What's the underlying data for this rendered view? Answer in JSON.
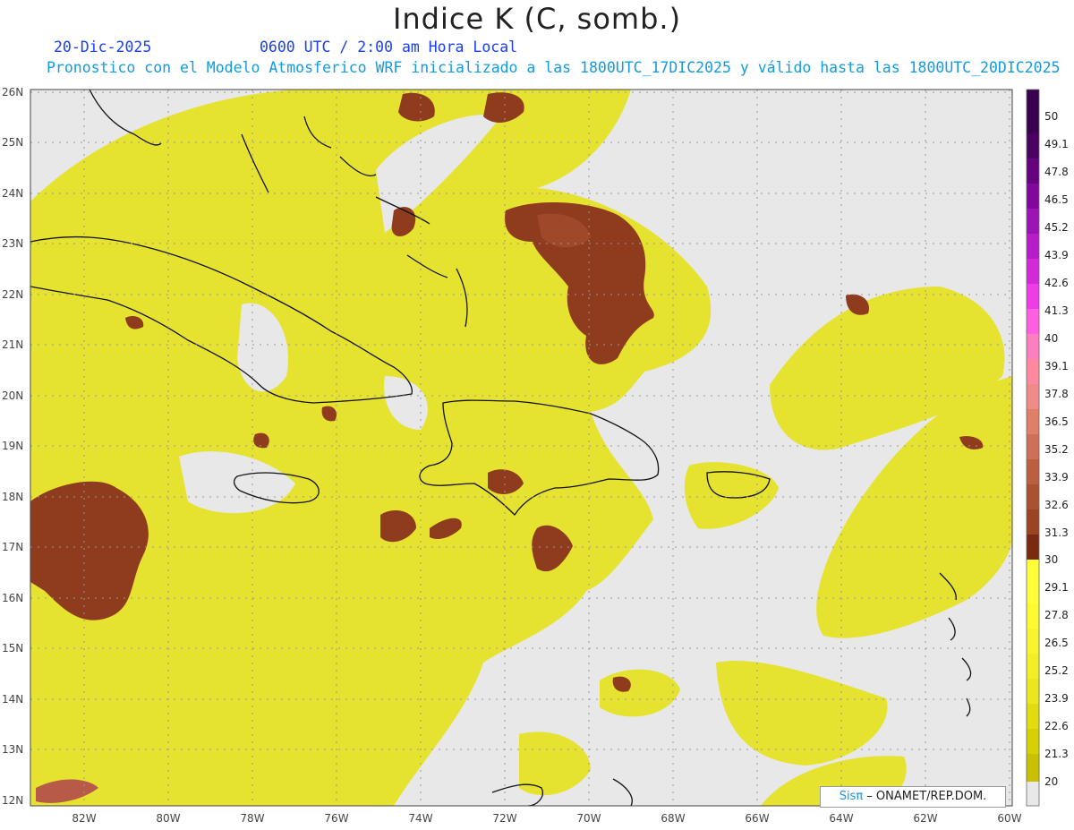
{
  "header": {
    "title": "Indice K (C, somb.)",
    "date": "20-Dic-2025",
    "time": "0600 UTC / 2:00 am Hora Local",
    "description": "Pronostico con el Modelo Atmosferico WRF inicializado a las 1800UTC_17DIC2025 y válido hasta las  1800UTC_20DIC2025"
  },
  "map": {
    "lat_labels": [
      "26N",
      "25N",
      "24N",
      "23N",
      "22N",
      "21N",
      "20N",
      "19N",
      "18N",
      "17N",
      "16N",
      "15N",
      "14N",
      "13N",
      "12N"
    ],
    "lon_labels": [
      "82W",
      "80W",
      "78W",
      "76W",
      "74W",
      "72W",
      "70W",
      "68W",
      "66W",
      "64W",
      "62W",
      "60W"
    ],
    "extent": {
      "lon_min": -83.3,
      "lon_max": -60.0,
      "lat_min": 11.9,
      "lat_max": 26.1
    },
    "background_color": "#e8e8e8",
    "gridlines": "dotted"
  },
  "legend": {
    "labels": [
      "50",
      "49.1",
      "47.8",
      "46.5",
      "45.2",
      "43.9",
      "42.6",
      "41.3",
      "40",
      "39.1",
      "37.8",
      "36.5",
      "35.2",
      "33.9",
      "32.6",
      "31.3",
      "30",
      "29.1",
      "27.8",
      "26.5",
      "25.2",
      "23.9",
      "22.6",
      "21.3",
      "20"
    ],
    "colors": [
      "#e8e8e8",
      "#c8c000",
      "#d6d000",
      "#e0dc10",
      "#eae620",
      "#f2ee28",
      "#f8f430",
      "#fdfa34",
      "#7a2a10",
      "#8a3618",
      "#9a4422",
      "#aa522e",
      "#ba6040",
      "#cc7058",
      "#de8068",
      "#ee8a88",
      "#ff7ec0",
      "#ff5fe0",
      "#ee3ce8",
      "#d22ad8",
      "#b81cc8",
      "#9c12b4",
      "#80089c",
      "#66007e",
      "#4a0062"
    ]
  },
  "credit": {
    "sis": "Sisπ",
    "text": " – ONAMET/REP.DOM."
  }
}
